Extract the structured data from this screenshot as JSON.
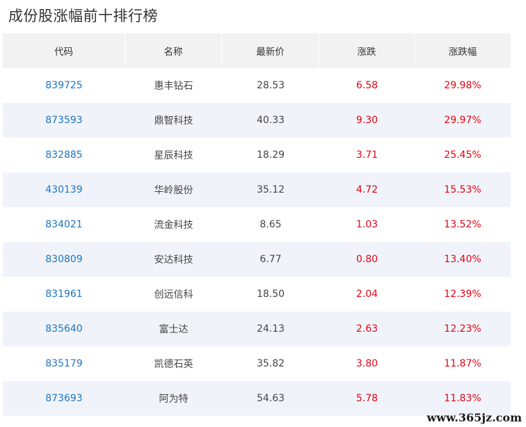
{
  "title": "成份股涨幅前十排行榜",
  "columns": {
    "code": "代码",
    "name": "名称",
    "price": "最新价",
    "change": "涨跌",
    "pct": "涨跌幅"
  },
  "rows": [
    {
      "code": "839725",
      "name": "惠丰钻石",
      "price": "28.53",
      "change": "6.58",
      "pct": "29.98%"
    },
    {
      "code": "873593",
      "name": "鼎智科技",
      "price": "40.33",
      "change": "9.30",
      "pct": "29.97%"
    },
    {
      "code": "832885",
      "name": "星辰科技",
      "price": "18.29",
      "change": "3.71",
      "pct": "25.45%"
    },
    {
      "code": "430139",
      "name": "华岭股份",
      "price": "35.12",
      "change": "4.72",
      "pct": "15.53%"
    },
    {
      "code": "834021",
      "name": "流金科技",
      "price": "8.65",
      "change": "1.03",
      "pct": "13.52%"
    },
    {
      "code": "830809",
      "name": "安达科技",
      "price": "6.77",
      "change": "0.80",
      "pct": "13.40%"
    },
    {
      "code": "831961",
      "name": "创远信科",
      "price": "18.50",
      "change": "2.04",
      "pct": "12.39%"
    },
    {
      "code": "835640",
      "name": "富士达",
      "price": "24.13",
      "change": "2.63",
      "pct": "12.23%"
    },
    {
      "code": "835179",
      "name": "凯德石英",
      "price": "35.82",
      "change": "3.80",
      "pct": "11.87%"
    },
    {
      "code": "873693",
      "name": "阿为特",
      "price": "54.63",
      "change": "5.78",
      "pct": "11.83%"
    }
  ],
  "watermark": "www.365jz.com",
  "colors": {
    "up": "#e60012",
    "link": "#1c74c4",
    "header_bg": "#f2f2f2",
    "stripe_bg": "#f0f4fa"
  }
}
